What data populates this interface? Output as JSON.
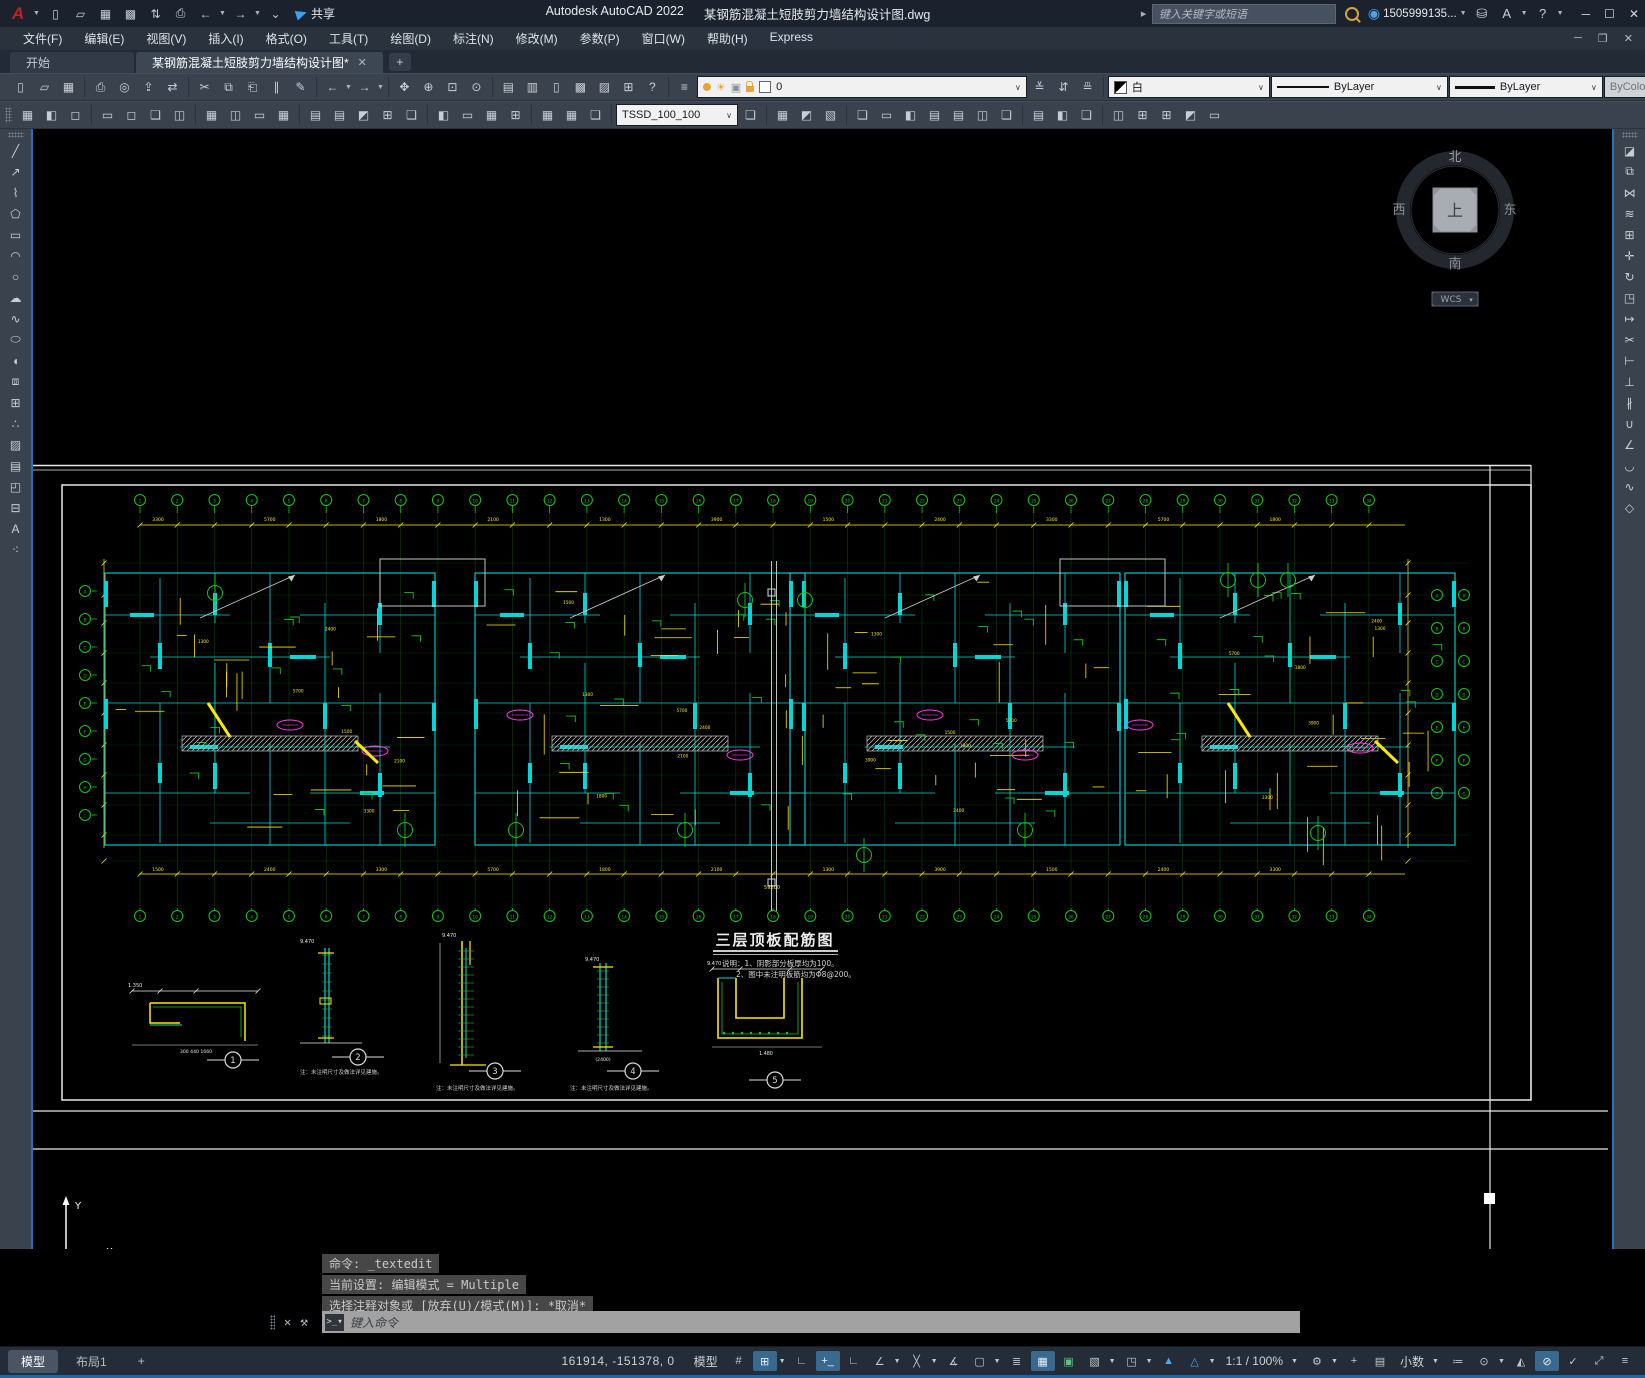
{
  "window": {
    "app_title": "Autodesk AutoCAD 2022",
    "doc_title": "某钢筋混凝土短肢剪力墙结构设计图.dwg",
    "share": "共享",
    "search_placeholder": "键入关键字或短语",
    "account": "1505999135...",
    "qat_icons": [
      "new",
      "open",
      "save",
      "save-as",
      "open-from-mobile",
      "plot",
      "undo",
      "redo",
      "customize-quick-access"
    ]
  },
  "menus": [
    "文件(F)",
    "编辑(E)",
    "视图(V)",
    "插入(I)",
    "格式(O)",
    "工具(T)",
    "绘图(D)",
    "标注(N)",
    "修改(M)",
    "参数(P)",
    "窗口(W)",
    "帮助(H)",
    "Express"
  ],
  "file_tabs": {
    "start": "开始",
    "active": "某钢筋混凝土短肢剪力墙结构设计图*",
    "new": "+"
  },
  "toolbar1": {
    "group_file": [
      "new",
      "open",
      "save"
    ],
    "group_plot": [
      "plot",
      "plot-preview",
      "publish",
      "etransmit"
    ],
    "group_edit": [
      "cut",
      "copy-clip",
      "paste",
      "match-properties",
      "edit-markup"
    ],
    "group_undo": [
      "undo",
      "redo"
    ],
    "group_zoom": [
      "pan",
      "zoom-realtime",
      "zoom-window",
      "zoom-previous"
    ],
    "group_palettes": [
      "properties",
      "design-center",
      "tool-palettes",
      "sheet-set-manager",
      "markup-set-manager",
      "quick-calc",
      "help"
    ],
    "layer_manager": "layer-properties",
    "layer_value": "0",
    "layer_tools": [
      "make-object-layer-current",
      "layer-previous",
      "layer-states"
    ],
    "color_value": "白",
    "linetype_value": "ByLayer",
    "lineweight_value": "ByLayer",
    "plotstyle_value": "ByColor"
  },
  "toolbar2": {
    "group_attr": [
      "edit-attribute",
      "block-attribute-manager",
      "draw-order"
    ],
    "dim_icons": [
      "dim-linear",
      "dim-aligned",
      "dim-arc-length",
      "dim-ordinate",
      "dim-radius",
      "dim-jogged",
      "dim-diameter",
      "dim-angular",
      "dim-quick",
      "dim-baseline",
      "dim-continue",
      "dim-space",
      "dim-break",
      "dim-tolerance",
      "dim-center-mark",
      "dim-inspect",
      "dim-jogged-linear",
      "dim-edit",
      "dim-text-edit",
      "dim-update"
    ],
    "dimstyle_value": "TSSD_100_100",
    "solid_icons": [
      "union",
      "subtract",
      "intersect",
      "extrude-faces",
      "move-faces",
      "offset-faces",
      "delete-faces",
      "rotate-faces",
      "taper-faces",
      "copy-faces",
      "color-faces",
      "copy-edges",
      "color-edges",
      "imprint",
      "clean",
      "separate",
      "shell",
      "check"
    ]
  },
  "draw_toolbar": [
    "line",
    "construction-line",
    "polyline",
    "polygon",
    "rectangle",
    "arc",
    "circle",
    "revision-cloud",
    "spline",
    "ellipse",
    "ellipse-arc",
    "insert-block",
    "make-block",
    "point",
    "hatch",
    "gradient",
    "region",
    "table",
    "multiline-text",
    "point-style"
  ],
  "modify_toolbar": [
    "erase",
    "copy",
    "mirror",
    "offset",
    "array",
    "move",
    "rotate",
    "scale",
    "stretch",
    "trim",
    "extend",
    "break-at-point",
    "break",
    "join",
    "chamfer",
    "fillet",
    "blend-curves",
    "explode"
  ],
  "viewcube": {
    "north": "北",
    "south": "南",
    "west": "西",
    "east": "东",
    "top": "上",
    "wcs": "WCS"
  },
  "ucs": {
    "x": "X",
    "y": "Y"
  },
  "drawing": {
    "title": "三层顶板配筋图",
    "notes": [
      "说明：1、阴影部分板厚均为100。",
      "2、图中未注明板筋均为Φ8@200。"
    ],
    "details": [
      {
        "no": "1",
        "note": ""
      },
      {
        "no": "2",
        "note": "注：未注明尺寸及做法详见建施。"
      },
      {
        "no": "3",
        "note": "注：未注明尺寸及做法详见建施。"
      },
      {
        "no": "4",
        "note": "注：未注明尺寸及做法详见建施。"
      },
      {
        "no": "5",
        "note": ""
      }
    ],
    "dim_texts": [
      "3300",
      "2100",
      "1500",
      "5700",
      "1300",
      "2400",
      "1800",
      "3900"
    ],
    "total_dim": "59200",
    "elevation": "9.470",
    "detail1_elev": "1.350",
    "detail1_dims": "300  440  1660",
    "detail4_dim": "(2400)",
    "detail5_dim": "1.480"
  },
  "command": {
    "history": [
      "命令: _textedit",
      "当前设置: 编辑模式 = Multiple",
      "选择注释对象或 [放弃(U)/模式(M)]: *取消*"
    ],
    "placeholder": "键入命令"
  },
  "status": {
    "model_tab": "模型",
    "layout_tab": "布局1",
    "new_layout": "+",
    "coords": "161914, -151378, 0",
    "model_label": "模型",
    "icons_a": [
      "grid",
      "snap",
      "snap-drop",
      "infer-constraints",
      "dynamic-input",
      "ortho",
      "polar-tracking",
      "polar-drop",
      "object-snap",
      "osnap-drop",
      "annotation-monitor",
      "transparency",
      "transparency-drop",
      "selection-cycling",
      "3d-object-snap",
      "dynamic-ucs",
      "selection-filter",
      "filter-drop",
      "gizmo",
      "gizmo-drop",
      "annotation-visibility",
      "autoscale",
      "autoscale-drop"
    ],
    "annotation_scale": "1:1 / 100%",
    "icons_b": [
      "workspace",
      "workspace-drop",
      "crosshair",
      "units-icon"
    ],
    "units": "小数",
    "icons_c": [
      "quick-properties",
      "lock-ui",
      "lock-drop",
      "isolate-objects",
      "hardware-acceleration",
      "graphics-performance",
      "clean-screen",
      "customization"
    ],
    "active_icons": [
      "snap",
      "dynamic-input",
      "3d-object-snap",
      "hardware-acceleration"
    ]
  }
}
